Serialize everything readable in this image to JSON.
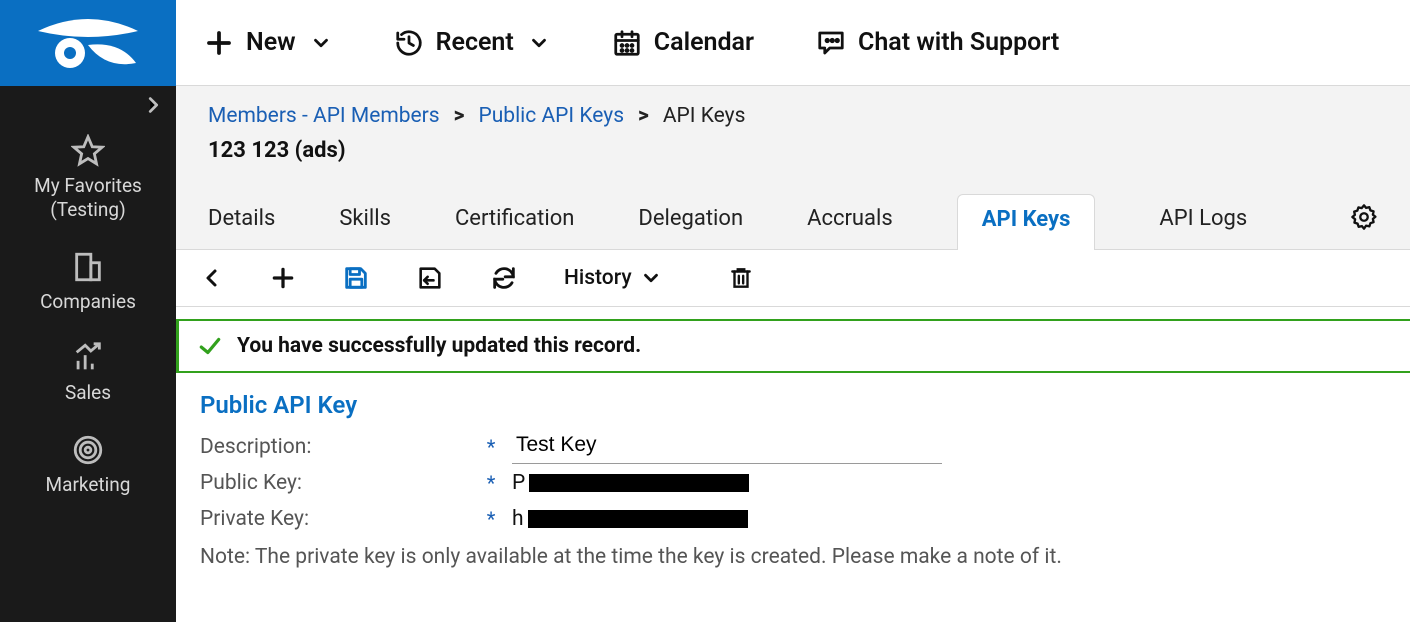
{
  "sidebar": {
    "items": [
      {
        "label": "My Favorites\n(Testing)"
      },
      {
        "label": "Companies"
      },
      {
        "label": "Sales"
      },
      {
        "label": "Marketing"
      }
    ]
  },
  "topbar": {
    "new": "New",
    "recent": "Recent",
    "calendar": "Calendar",
    "chat": "Chat with Support"
  },
  "breadcrumb": {
    "a": "Members - API Members",
    "b": "Public API Keys",
    "c": "API Keys"
  },
  "record_title": "123 123 (ads)",
  "tabs": {
    "details": "Details",
    "skills": "Skills",
    "certification": "Certification",
    "delegation": "Delegation",
    "accruals": "Accruals",
    "api_keys": "API Keys",
    "api_logs": "API Logs"
  },
  "toolbar": {
    "history": "History"
  },
  "banner": {
    "message": "You have successfully updated this record."
  },
  "form": {
    "section_title": "Public API Key",
    "description_label": "Description:",
    "description_value": "Test Key",
    "public_key_label": "Public Key:",
    "public_key_prefix": "P",
    "private_key_label": "Private Key:",
    "private_key_prefix": "h",
    "note": "Note: The private key is only available at the time the key is created. Please make a note of it."
  }
}
